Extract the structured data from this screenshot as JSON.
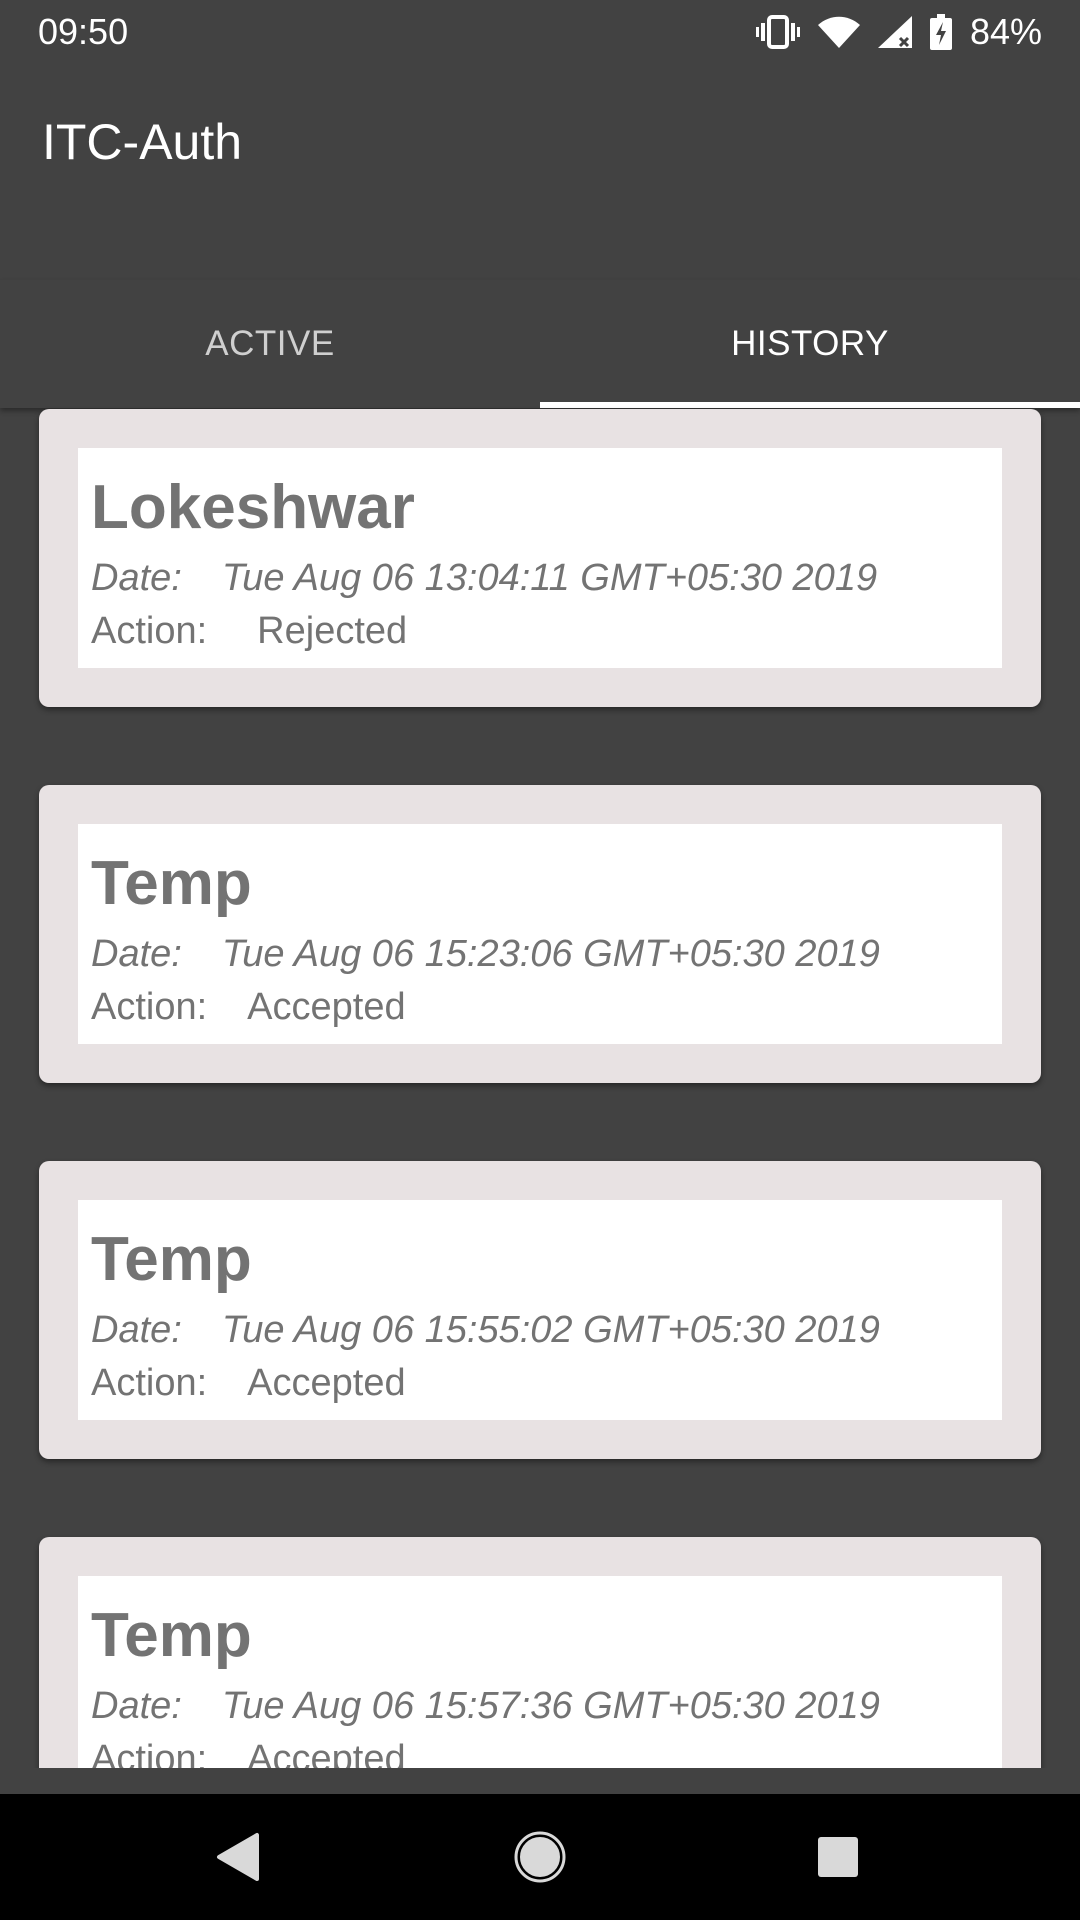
{
  "status_bar": {
    "time": "09:50",
    "battery_percent": "84%",
    "icons": [
      "vibrate-icon",
      "wifi-icon",
      "cellular-signal-icon",
      "battery-charging-icon"
    ]
  },
  "app_bar": {
    "title": "ITC-Auth"
  },
  "tabs": [
    {
      "label": "ACTIVE",
      "selected": false
    },
    {
      "label": "HISTORY",
      "selected": true
    }
  ],
  "history": [
    {
      "name": "Lokeshwar",
      "date_label": "Date:",
      "date": "Tue Aug 06 13:04:11 GMT+05:30 2019",
      "action_label": "Action:",
      "action": "Rejected"
    },
    {
      "name": "Temp",
      "date_label": "Date:",
      "date": "Tue Aug 06 15:23:06 GMT+05:30 2019",
      "action_label": "Action:",
      "action": "Accepted"
    },
    {
      "name": "Temp",
      "date_label": "Date:",
      "date": "Tue Aug 06 15:55:02 GMT+05:30 2019",
      "action_label": "Action:",
      "action": "Accepted"
    },
    {
      "name": "Temp",
      "date_label": "Date:",
      "date": "Tue Aug 06 15:57:36 GMT+05:30 2019",
      "action_label": "Action:",
      "action": "Accepted"
    }
  ],
  "nav_bar": {
    "buttons": [
      "back-icon",
      "home-icon",
      "recents-icon"
    ]
  },
  "colors": {
    "background": "#424242",
    "card_outer": "#e8e2e3",
    "card_inner": "#ffffff",
    "card_text": "#737373",
    "nav_bar": "#000000"
  }
}
